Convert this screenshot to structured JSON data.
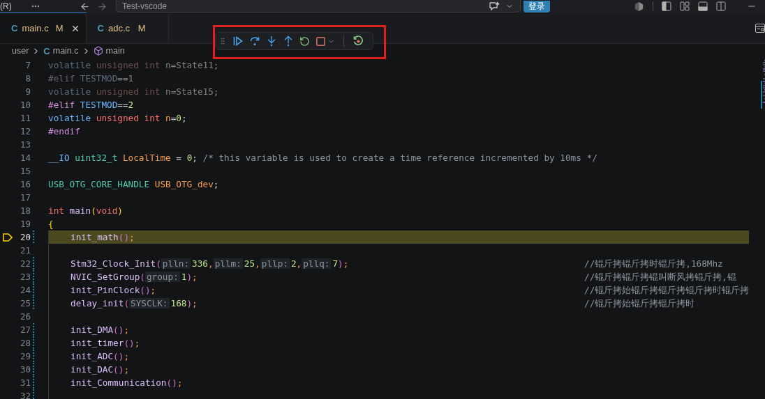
{
  "title_bar": {
    "menu": "(R)",
    "command_center": "Test-vscode",
    "login_button": "登录"
  },
  "tabs": [
    {
      "file_icon": "C",
      "label": "main.c",
      "badge": "M",
      "selected": true
    },
    {
      "file_icon": "C",
      "label": "adc.c",
      "badge": "M",
      "selected": false
    }
  ],
  "breadcrumb": [
    {
      "kind": "folder",
      "label": "user"
    },
    {
      "kind": "file",
      "file_icon": "C",
      "label": "main.c"
    },
    {
      "kind": "symbol",
      "label": "main"
    }
  ],
  "editor": {
    "lines": [
      {
        "number": "7",
        "dimmed": true,
        "current": false,
        "changed": false,
        "indented": false,
        "tokens": [
          {
            "text": "volatile",
            "kind": "keyword"
          },
          {
            "text": " unsigned int",
            "kind": "type_keyword"
          },
          {
            "text": " n=State11;",
            "kind": "plain"
          }
        ]
      },
      {
        "number": "8",
        "dimmed": true,
        "current": false,
        "changed": false,
        "indented": false,
        "tokens": [
          {
            "text": "#elif",
            "kind": "directive"
          },
          {
            "text": " TESTMOD",
            "kind": "macro"
          },
          {
            "text": "==",
            "kind": "plain"
          },
          {
            "text": "1",
            "kind": "number"
          }
        ]
      },
      {
        "number": "9",
        "dimmed": true,
        "current": false,
        "changed": false,
        "indented": false,
        "tokens": [
          {
            "text": "volatile",
            "kind": "keyword"
          },
          {
            "text": " unsigned int",
            "kind": "type_keyword"
          },
          {
            "text": " n=State15;",
            "kind": "plain"
          }
        ]
      },
      {
        "number": "10",
        "dimmed": false,
        "current": false,
        "changed": false,
        "indented": false,
        "tokens": [
          {
            "text": "#elif",
            "kind": "directive"
          },
          {
            "text": " TESTMOD",
            "kind": "macro"
          },
          {
            "text": "==",
            "kind": "plain"
          },
          {
            "text": "2",
            "kind": "number"
          }
        ]
      },
      {
        "number": "11",
        "dimmed": false,
        "current": false,
        "changed": false,
        "indented": false,
        "tokens": [
          {
            "text": "volatile",
            "kind": "keyword"
          },
          {
            "text": " unsigned int",
            "kind": "type_keyword"
          },
          {
            "text": " n",
            "kind": "variable"
          },
          {
            "text": "=",
            "kind": "plain"
          },
          {
            "text": "0",
            "kind": "number"
          },
          {
            "text": ";",
            "kind": "plain"
          }
        ]
      },
      {
        "number": "12",
        "dimmed": false,
        "current": false,
        "changed": false,
        "indented": false,
        "tokens": [
          {
            "text": "#endif",
            "kind": "directive"
          }
        ]
      },
      {
        "number": "13",
        "current": false,
        "changed": false,
        "indented": false
      },
      {
        "number": "14",
        "dimmed": false,
        "current": false,
        "changed": false,
        "indented": false,
        "tokens": [
          {
            "text": "__IO",
            "kind": "keyword"
          },
          {
            "text": " uint32_t",
            "kind": "type"
          },
          {
            "text": " LocalTime",
            "kind": "variable"
          },
          {
            "text": " = ",
            "kind": "plain"
          },
          {
            "text": "0",
            "kind": "number"
          },
          {
            "text": "; ",
            "kind": "plain"
          },
          {
            "text": "/* this variable is used to create a time reference incremented by 10ms */",
            "kind": "comment"
          }
        ]
      },
      {
        "number": "15",
        "current": false,
        "changed": false,
        "indented": false
      },
      {
        "number": "16",
        "dimmed": false,
        "current": false,
        "changed": false,
        "indented": false,
        "tokens": [
          {
            "text": "USB_OTG_CORE_HANDLE",
            "kind": "type"
          },
          {
            "text": " USB_OTG_dev",
            "kind": "variable"
          },
          {
            "text": ";",
            "kind": "plain"
          }
        ]
      },
      {
        "number": "17",
        "current": false,
        "changed": false,
        "indented": false
      },
      {
        "number": "18",
        "dimmed": false,
        "current": false,
        "changed": false,
        "indented": false,
        "tokens": [
          {
            "text": "int",
            "kind": "type_keyword"
          },
          {
            "text": " main",
            "kind": "function"
          },
          {
            "text": "(",
            "kind": "bracket"
          },
          {
            "text": "void",
            "kind": "type_keyword"
          },
          {
            "text": ")",
            "kind": "bracket"
          }
        ]
      },
      {
        "number": "19",
        "dimmed": false,
        "current": false,
        "changed": false,
        "indented": false,
        "tokens": [
          {
            "text": "{",
            "kind": "bracket"
          }
        ]
      },
      {
        "number": "20",
        "dimmed": false,
        "current": true,
        "changed": true,
        "indented": true,
        "tokens": [
          {
            "text": "init_math",
            "kind": "function"
          },
          {
            "text": "()",
            "kind": "paren"
          },
          {
            "text": ";",
            "kind": "punct"
          }
        ]
      },
      {
        "number": "21",
        "current": false,
        "changed": false,
        "indented": true
      },
      {
        "number": "22",
        "dimmed": false,
        "current": false,
        "changed": true,
        "indented": true,
        "tokens": [
          {
            "text": "Stm32_Clock_Init",
            "kind": "function"
          },
          {
            "text": "(",
            "kind": "paren"
          },
          {
            "text": "plln:",
            "kind": "hint"
          },
          {
            "text": "336",
            "kind": "number"
          },
          {
            "text": ",",
            "kind": "punct"
          },
          {
            "text": "pllm:",
            "kind": "hint"
          },
          {
            "text": "25",
            "kind": "number"
          },
          {
            "text": ",",
            "kind": "punct"
          },
          {
            "text": "pllp:",
            "kind": "hint"
          },
          {
            "text": "2",
            "kind": "number"
          },
          {
            "text": ",",
            "kind": "punct"
          },
          {
            "text": "pllq:",
            "kind": "hint"
          },
          {
            "text": "7",
            "kind": "number"
          },
          {
            "text": ")",
            "kind": "paren"
          },
          {
            "text": ";",
            "kind": "punct"
          }
        ],
        "comment": "//锟斤拷锟斤拷时锟斤拷,168Mhz"
      },
      {
        "number": "23",
        "dimmed": false,
        "current": false,
        "changed": true,
        "indented": true,
        "tokens": [
          {
            "text": "NVIC_SetGroup",
            "kind": "function"
          },
          {
            "text": "(",
            "kind": "paren"
          },
          {
            "text": "group:",
            "kind": "hint"
          },
          {
            "text": "1",
            "kind": "number"
          },
          {
            "text": ")",
            "kind": "paren"
          },
          {
            "text": ";",
            "kind": "punct"
          }
        ],
        "comment": "//锟斤拷锟斤拷锟叫断风拷锟斤拷,锟"
      },
      {
        "number": "24",
        "dimmed": false,
        "current": false,
        "changed": true,
        "indented": true,
        "tokens": [
          {
            "text": "init_PinClock",
            "kind": "function"
          },
          {
            "text": "()",
            "kind": "paren"
          },
          {
            "text": ";",
            "kind": "punct"
          }
        ],
        "comment": "//锟斤拷始锟斤拷锟斤拷锟斤拷时锟斤拷"
      },
      {
        "number": "25",
        "dimmed": false,
        "current": false,
        "changed": true,
        "indented": true,
        "tokens": [
          {
            "text": "delay_init",
            "kind": "function"
          },
          {
            "text": "(",
            "kind": "paren"
          },
          {
            "text": "SYSCLK:",
            "kind": "hint"
          },
          {
            "text": "168",
            "kind": "number"
          },
          {
            "text": ")",
            "kind": "paren"
          },
          {
            "text": ";",
            "kind": "punct"
          }
        ],
        "comment": "//锟斤拷始锟斤拷锟斤拷时"
      },
      {
        "number": "26",
        "current": false,
        "changed": false,
        "indented": true
      },
      {
        "number": "27",
        "dimmed": false,
        "current": false,
        "changed": true,
        "indented": true,
        "tokens": [
          {
            "text": "init_DMA",
            "kind": "function"
          },
          {
            "text": "()",
            "kind": "paren"
          },
          {
            "text": ";",
            "kind": "punct"
          }
        ]
      },
      {
        "number": "28",
        "dimmed": false,
        "current": false,
        "changed": true,
        "indented": true,
        "tokens": [
          {
            "text": "init_timer",
            "kind": "function"
          },
          {
            "text": "()",
            "kind": "paren"
          },
          {
            "text": ";",
            "kind": "punct"
          }
        ]
      },
      {
        "number": "29",
        "dimmed": false,
        "current": false,
        "changed": true,
        "indented": true,
        "tokens": [
          {
            "text": "init_ADC",
            "kind": "function"
          },
          {
            "text": "()",
            "kind": "paren"
          },
          {
            "text": ";",
            "kind": "punct"
          }
        ]
      },
      {
        "number": "30",
        "dimmed": false,
        "current": false,
        "changed": true,
        "indented": true,
        "tokens": [
          {
            "text": "init_DAC",
            "kind": "function"
          },
          {
            "text": "()",
            "kind": "paren"
          },
          {
            "text": ";",
            "kind": "punct"
          }
        ]
      },
      {
        "number": "31",
        "dimmed": false,
        "current": false,
        "changed": true,
        "indented": true,
        "tokens": [
          {
            "text": "init_Communication",
            "kind": "function"
          },
          {
            "text": "()",
            "kind": "paren"
          },
          {
            "text": ";",
            "kind": "punct"
          }
        ]
      },
      {
        "number": "32",
        "current": false,
        "changed": true,
        "indented": true
      }
    ]
  }
}
